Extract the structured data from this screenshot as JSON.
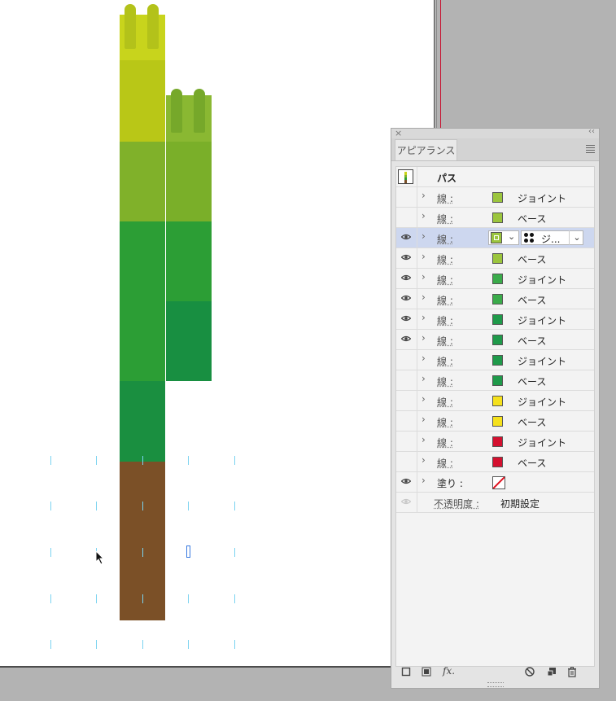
{
  "colors": {
    "lime": "#bfcc1a",
    "yellow_green": "#8ab832",
    "mid_green": "#2c9e35",
    "dark_green": "#1a8f40",
    "brown": "#7b5027",
    "guide": "#7ad3f0",
    "selection_row": "#cdd7ef"
  },
  "panel": {
    "tab_label": "アピアランス",
    "title_row": "パス",
    "rows": [
      {
        "visible": false,
        "label": "線 :",
        "swatch": "#9bc53d",
        "name": "ジョイント"
      },
      {
        "visible": false,
        "label": "線 :",
        "swatch": "#9bc53d",
        "name": "ベース"
      },
      {
        "visible": true,
        "label": "線 :",
        "swatch": "#9bc53d",
        "name": "ジ...",
        "selected": true
      },
      {
        "visible": true,
        "label": "線 :",
        "swatch": "#9bc53d",
        "name": "ベース"
      },
      {
        "visible": true,
        "label": "線 :",
        "swatch": "#3aab4a",
        "name": "ジョイント"
      },
      {
        "visible": true,
        "label": "線 :",
        "swatch": "#3aab4a",
        "name": "ベース"
      },
      {
        "visible": true,
        "label": "線 :",
        "swatch": "#1f9a4a",
        "name": "ジョイント"
      },
      {
        "visible": true,
        "label": "線 :",
        "swatch": "#1f9a4a",
        "name": "ベース"
      },
      {
        "visible": false,
        "label": "線 :",
        "swatch": "#1f9a4a",
        "name": "ジョイント"
      },
      {
        "visible": false,
        "label": "線 :",
        "swatch": "#1f9a4a",
        "name": "ベース"
      },
      {
        "visible": false,
        "label": "線 :",
        "swatch": "#f5e11c",
        "name": "ジョイント"
      },
      {
        "visible": false,
        "label": "線 :",
        "swatch": "#f5e11c",
        "name": "ベース"
      },
      {
        "visible": false,
        "label": "線 :",
        "swatch": "#d4102f",
        "name": "ジョイント"
      },
      {
        "visible": false,
        "label": "線 :",
        "swatch": "#d4102f",
        "name": "ベース"
      }
    ],
    "fill_row": {
      "label": "塗り :"
    },
    "opacity_row": {
      "label": "不透明度 :",
      "value": "初期設定"
    },
    "bottom_icons": [
      "new-stroke-icon",
      "new-fill-icon",
      "fx-icon",
      "clear-icon",
      "duplicate-icon",
      "trash-icon"
    ],
    "fx_label": "fx."
  }
}
